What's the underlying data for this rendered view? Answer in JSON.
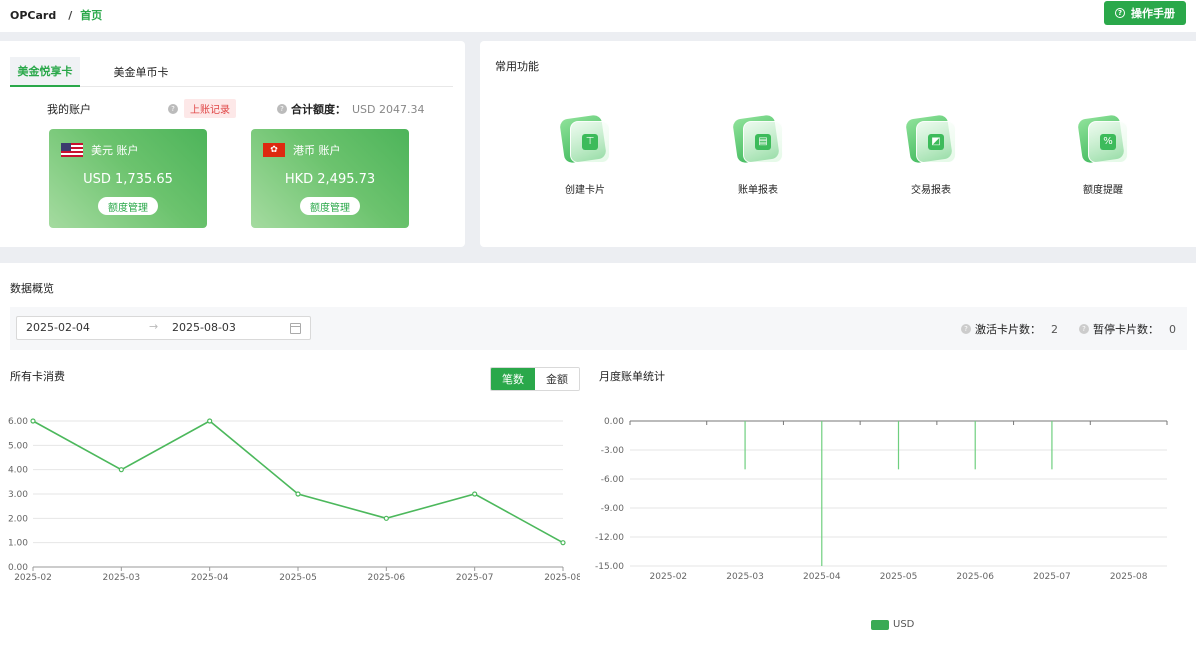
{
  "header": {
    "brand": "OPCard",
    "separator": "/",
    "current": "首页",
    "manual_label": "操作手册"
  },
  "account_panel": {
    "tabs": [
      {
        "label": "美金悦享卡",
        "active": true
      },
      {
        "label": "美金单币卡",
        "active": false
      }
    ],
    "my_account_label": "我的账户",
    "ledger_label": "上账记录",
    "total_label": "合计额度：",
    "total_value": "USD 2047.34",
    "cards": [
      {
        "name": "美元 账户",
        "amount": "USD 1,735.65",
        "action": "额度管理",
        "flag": "us-flag-icon"
      },
      {
        "name": "港币 账户",
        "amount": "HKD 2,495.73",
        "action": "额度管理",
        "flag": "hk-flag-icon"
      }
    ]
  },
  "functions": {
    "title": "常用功能",
    "items": [
      {
        "label": "创建卡片",
        "icon": "create-card-icon",
        "glyph": "⊤"
      },
      {
        "label": "账单报表",
        "icon": "bill-report-icon",
        "glyph": "▤"
      },
      {
        "label": "交易报表",
        "icon": "transaction-report-icon",
        "glyph": "◩"
      },
      {
        "label": "额度提醒",
        "icon": "limit-alert-icon",
        "glyph": "%"
      }
    ]
  },
  "overview": {
    "title": "数据概览",
    "start_date": "2025-02-04",
    "end_date": "2025-08-03",
    "range_arrow": "→",
    "active_cards_label": "激活卡片数：",
    "active_cards_value": "2",
    "paused_cards_label": "暂停卡片数：",
    "paused_cards_value": "0"
  },
  "consumption": {
    "title": "所有卡消费",
    "toggle": [
      {
        "label": "笔数",
        "active": true
      },
      {
        "label": "金额",
        "active": false
      }
    ]
  },
  "monthly": {
    "title": "月度账单统计",
    "legend": "USD"
  },
  "colors": {
    "accent": "#2aa84a",
    "line": "#4cb85c",
    "bar": "#6fcf7f"
  },
  "chart_data": [
    {
      "type": "line",
      "x": [
        "2025-02",
        "2025-03",
        "2025-04",
        "2025-05",
        "2025-06",
        "2025-07",
        "2025-08"
      ],
      "series": [
        {
          "values": [
            6,
            4,
            6,
            3,
            2,
            3,
            1
          ]
        }
      ],
      "yticks": [
        "0.00",
        "1.00",
        "2.00",
        "3.00",
        "4.00",
        "5.00",
        "6.00"
      ],
      "ylim": [
        0,
        6
      ],
      "grid": true
    },
    {
      "type": "bar",
      "x": [
        "2025-02",
        "2025-03",
        "2025-04",
        "2025-05",
        "2025-06",
        "2025-07",
        "2025-08"
      ],
      "series": [
        {
          "name": "USD",
          "values": [
            0,
            -5,
            -15,
            -5,
            -5,
            -5,
            0
          ]
        }
      ],
      "yticks": [
        "0.00",
        "-3.00",
        "-6.00",
        "-9.00",
        "-12.00",
        "-15.00"
      ],
      "ylim": [
        -15,
        0
      ],
      "grid": true,
      "legend": "bottom-center"
    }
  ]
}
